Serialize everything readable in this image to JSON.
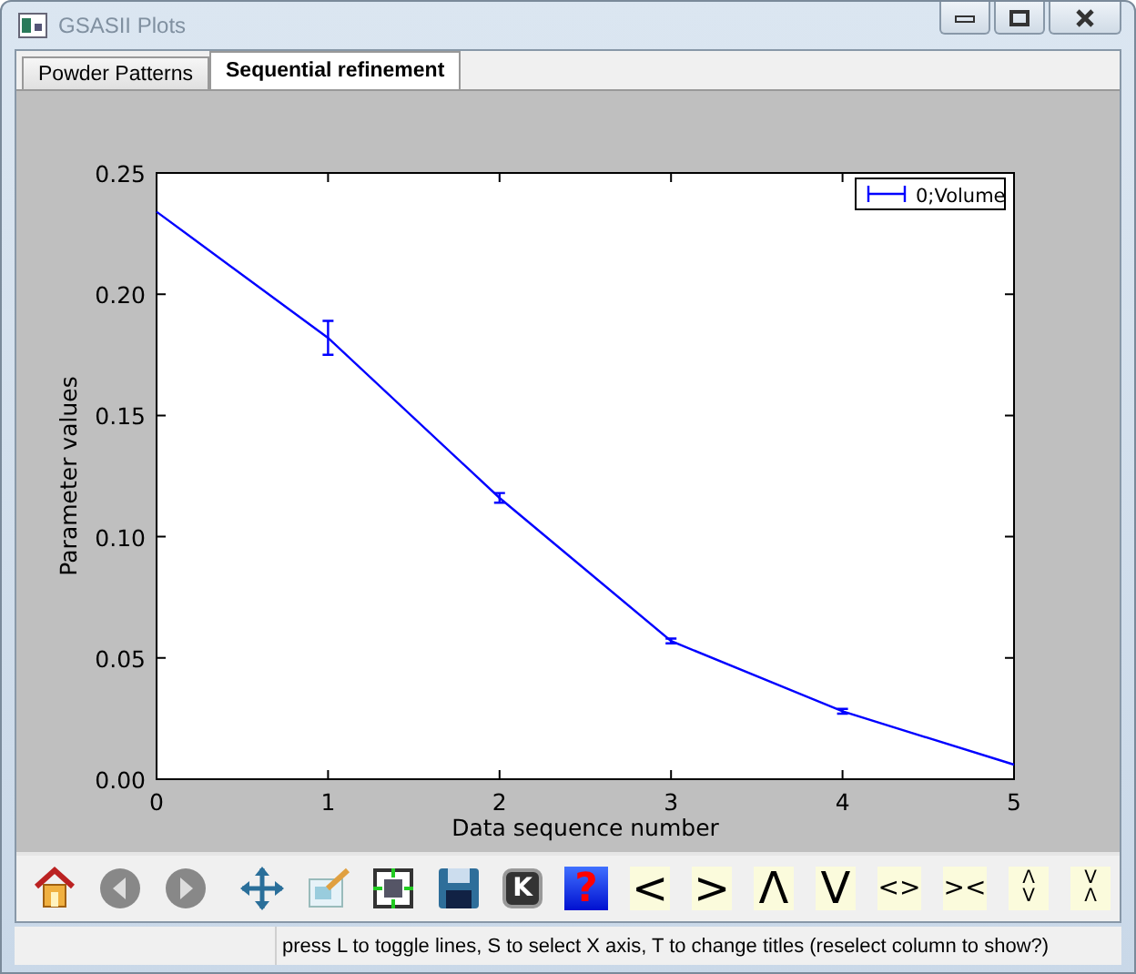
{
  "window": {
    "title": "GSASII Plots",
    "active": false
  },
  "tabs": [
    {
      "label": "Powder Patterns",
      "selected": false
    },
    {
      "label": "Sequential refinement",
      "selected": true
    }
  ],
  "plot": {
    "chart_data": {
      "type": "line",
      "xlabel": "Data sequence number",
      "ylabel": "Parameter values",
      "x": [
        0,
        1,
        2,
        3,
        4,
        5
      ],
      "series": [
        {
          "name": "0;Volume",
          "color": "#0000ff",
          "values": [
            0.234,
            0.182,
            0.116,
            0.057,
            0.028,
            0.006
          ],
          "errors": [
            0,
            0.007,
            0.002,
            0.001,
            0.001,
            0
          ]
        }
      ],
      "xlim": [
        0,
        5
      ],
      "ylim": [
        0,
        0.25
      ],
      "xticks": [
        0,
        1,
        2,
        3,
        4,
        5
      ],
      "yticks": [
        {
          "value": 0,
          "label": "0.00"
        },
        {
          "value": 0.05,
          "label": "0.05"
        },
        {
          "value": 0.1,
          "label": "0.10"
        },
        {
          "value": 0.15,
          "label": "0.15"
        },
        {
          "value": 0.2,
          "label": "0.20"
        },
        {
          "value": 0.25,
          "label": "0.25"
        }
      ]
    }
  },
  "toolbar": [
    {
      "kind": "key",
      "label": "K"
    },
    {
      "kind": "help",
      "label": "?"
    },
    {
      "kind": "big",
      "label": "<"
    },
    {
      "kind": "big",
      "label": ">"
    },
    {
      "kind": "big",
      "label": "Λ"
    },
    {
      "kind": "big",
      "label": "V"
    },
    {
      "kind": "small",
      "label": "<>"
    },
    {
      "kind": "small",
      "label": "><"
    },
    {
      "kind": "stack",
      "label": "Λ\nV"
    },
    {
      "kind": "stack",
      "label": "V\nΛ"
    }
  ],
  "status_bar": {
    "fields": [
      "press L to toggle lines, S to select X axis, T to change titles (reselect column to show?)"
    ]
  }
}
